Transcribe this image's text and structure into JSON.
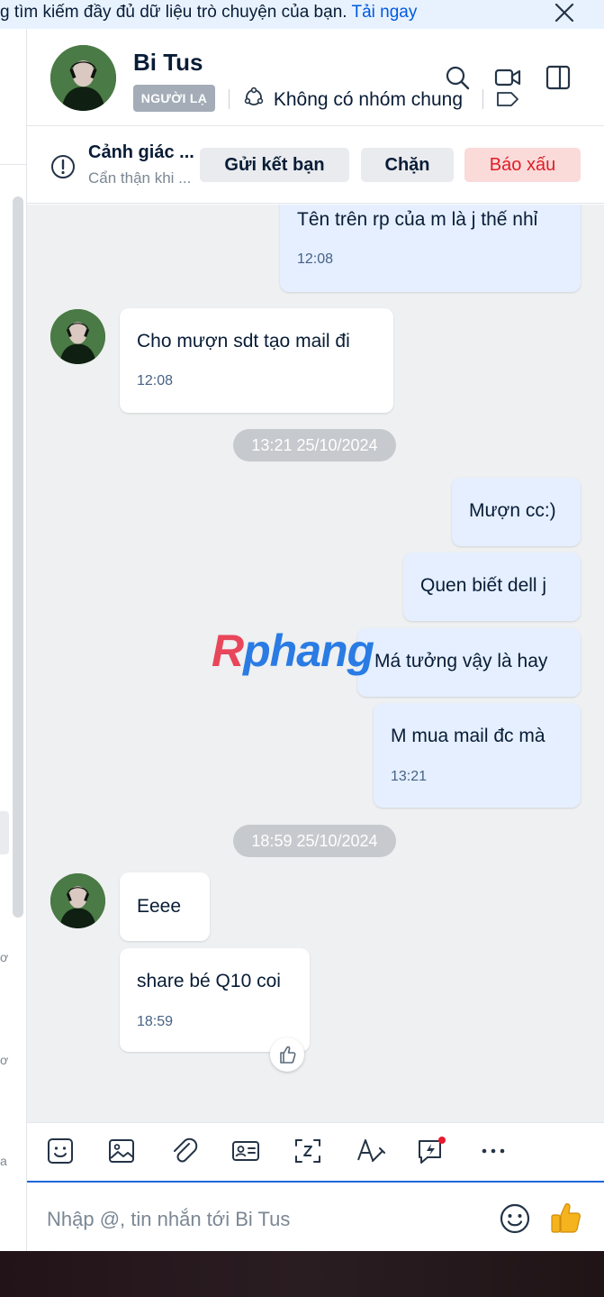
{
  "banner": {
    "text": "g tìm kiếm đầy đủ dữ liệu trò chuyện của bạn.",
    "link": "Tải ngay"
  },
  "header": {
    "name": "Bi Tus",
    "badge": "NGƯỜI LẠ",
    "group_info": "Không có nhóm chung"
  },
  "warning": {
    "title": "Cảnh giác ...",
    "subtitle": "Cẩn thận khi ...",
    "add_friend": "Gửi kết bạn",
    "block": "Chặn",
    "report": "Báo xấu"
  },
  "left_fragments": [
    "ơ",
    "ơ",
    "a"
  ],
  "messages": {
    "m1": {
      "text": "Tên trên rp của m là j thế nhỉ",
      "time": "12:08"
    },
    "m2": {
      "text": "Cho mượn sdt tạo mail đi",
      "time": "12:08"
    },
    "stamp1": "13:21 25/10/2024",
    "m3": {
      "text": "Mượn cc:)"
    },
    "m4": {
      "text": "Quen biết dell j"
    },
    "m5": {
      "text": "Má tưởng vậy là hay"
    },
    "m6": {
      "text": "M mua mail đc mà",
      "time": "13:21"
    },
    "stamp2": "18:59 25/10/2024",
    "m7": {
      "text": "Eeee"
    },
    "m8": {
      "text": "share bé Q10 coi",
      "time": "18:59"
    }
  },
  "watermark": {
    "part1": "R",
    "part2": "phang"
  },
  "toolbar": {
    "icons": [
      "sticker-icon",
      "image-icon",
      "attachment-icon",
      "contact-card-icon",
      "screenshot-icon",
      "text-format-icon",
      "quick-message-icon",
      "more-icon"
    ]
  },
  "input": {
    "placeholder": "Nhập @, tin nhắn tới Bi Tus"
  },
  "colors": {
    "accent": "#005ae0",
    "outgoing_bubble": "#e5efff",
    "incoming_bubble": "#ffffff",
    "chat_background": "#eef0f1",
    "report_text": "#dc1f26"
  }
}
